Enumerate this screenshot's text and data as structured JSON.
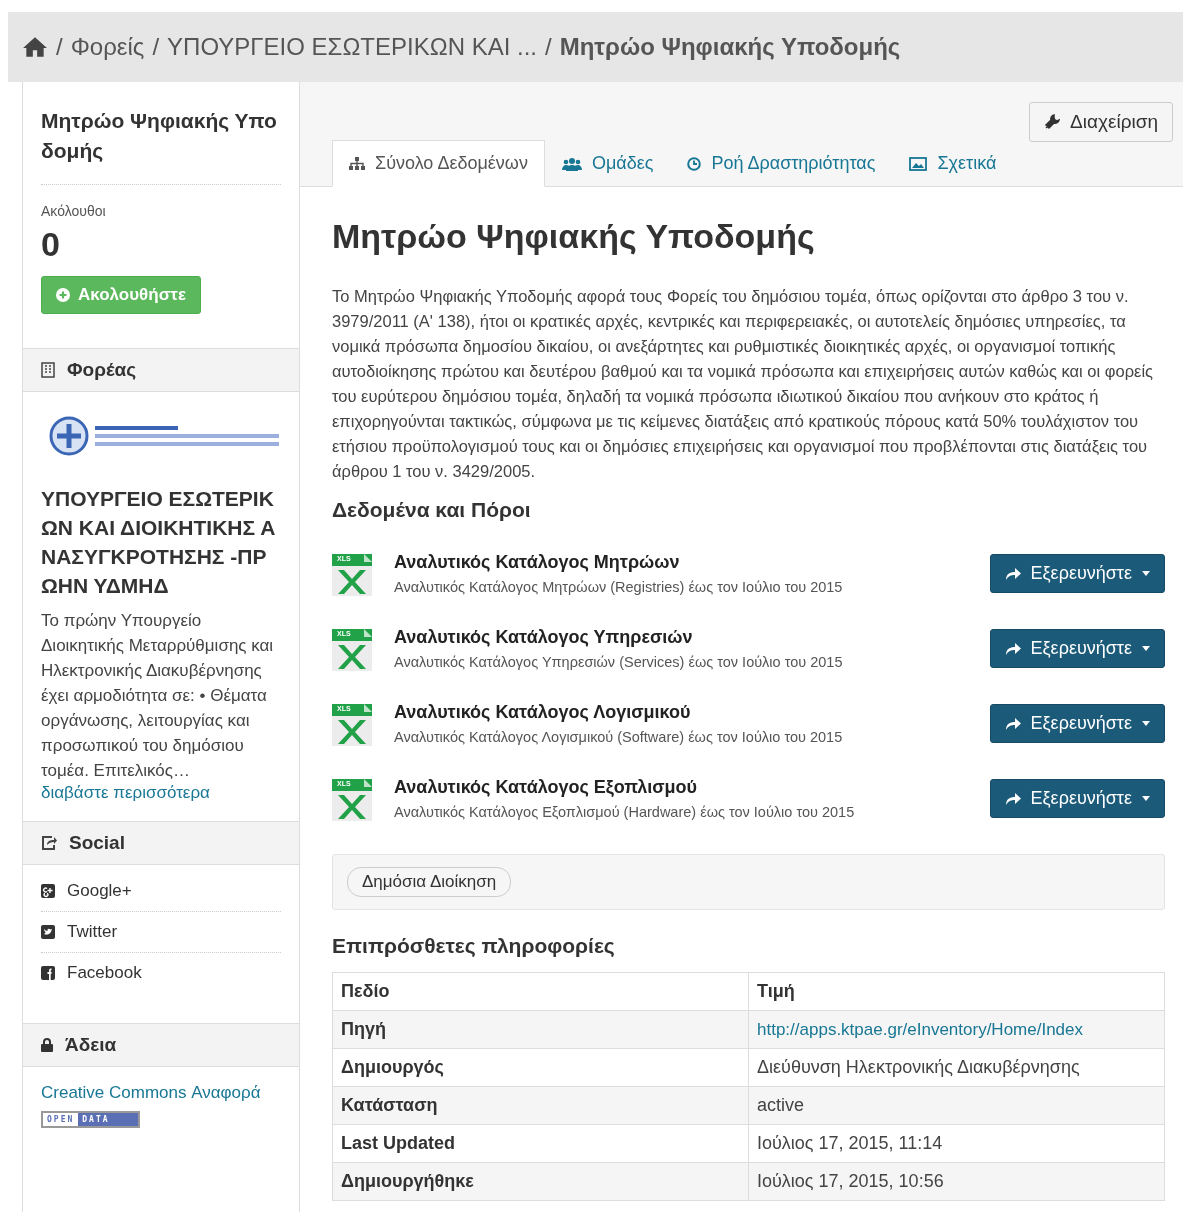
{
  "breadcrumb": {
    "items": [
      "Φορείς",
      "ΥΠΟΥΡΓΕΙΟ ΕΣΩΤΕΡΙΚΩΝ ΚΑΙ ...",
      "Μητρώο Ψηφιακής Υποδομής"
    ],
    "separator": "/"
  },
  "sidebar": {
    "title": "Μητρώο Ψηφιακής Υποδομής",
    "followers_label": "Ακόλουθοι",
    "followers_count": "0",
    "follow_button": "Ακολουθήστε",
    "organization": {
      "heading": "Φορέας",
      "name": "ΥΠΟΥΡΓΕΙΟ ΕΣΩΤΕΡΙΚΩΝ ΚΑΙ ΔΙΟΙΚΗΤΙΚΗΣ ΑΝΑΣΥΓΚΡΟΤΗΣΗΣ -ΠΡΩΗΝ ΥΔΜΗΔ",
      "description": "Το πρώην Υπουργείο Διοικητικής Μεταρρύθμισης και Ηλεκτρονικής Διακυβέρνησης έχει αρμοδιότητα σε: • Θέματα οργάνωσης, λειτουργίας και προσωπικού του δημόσιου τομέα. Επιτελικός…",
      "read_more": "διαβάστε περισσότερα"
    },
    "social": {
      "heading": "Social",
      "items": [
        {
          "kind": "googleplus",
          "label": "Google+"
        },
        {
          "kind": "twitter",
          "label": "Twitter"
        },
        {
          "kind": "facebook",
          "label": "Facebook"
        }
      ]
    },
    "license": {
      "heading": "Άδεια",
      "link": "Creative Commons Αναφορά",
      "badge": [
        "OPEN",
        "DATA"
      ]
    }
  },
  "manage_button": "Διαχείριση",
  "tabs": [
    {
      "kind": "dataset",
      "label": "Σύνολο Δεδομένων",
      "selected": true
    },
    {
      "kind": "groups",
      "label": "Ομάδες",
      "selected": false
    },
    {
      "kind": "activity",
      "label": "Ροή Δραστηριότητας",
      "selected": false
    },
    {
      "kind": "related",
      "label": "Σχετικά",
      "selected": false
    }
  ],
  "dataset": {
    "title": "Μητρώο Ψηφιακής Υποδομής",
    "description": "Το Μητρώο Ψηφιακής Υποδομής αφορά τους Φορείς του δημόσιου τομέα, όπως ορίζονται στο άρθρο 3 του ν. 3979/2011 (Α' 138), ήτοι οι κρατικές αρχές, κεντρικές και περιφερειακές, οι αυτοτελείς δημόσιες υπηρεσίες, τα νομικά πρόσωπα δημοσίου δικαίου, οι ανεξάρτητες και ρυθμιστικές διοικητικές αρχές, οι οργανισμοί τοπικής αυτοδιοίκησης πρώτου και δευτέρου βαθμού και τα νομικά πρόσωπα και επιχειρήσεις αυτών καθώς και οι φορείς του ευρύτερου δημόσιου τομέα, δηλαδή τα νομικά πρόσωπα ιδιωτικού δικαίου που ανήκουν στο κράτος ή επιχορηγούνται τακτικώς, σύμφωνα με τις κείμενες διατάξεις από κρατικούς πόρους κατά 50% τουλάχιστον του ετήσιου προϋπολογισμού τους και οι δημόσιες επιχειρήσεις και οργανισμοί που προβλέπονται στις διατάξεις του άρθρου 1 του ν. 3429/2005."
  },
  "resources_heading": "Δεδομένα και Πόροι",
  "resources": [
    {
      "title": "Αναλυτικός Κατάλογος Μητρώων",
      "description": "Αναλυτικός Κατάλογος Μητρώων (Registries) έως τον Ιούλιο του 2015",
      "format": "XLS",
      "button": "Εξερευνήστε"
    },
    {
      "title": "Αναλυτικός Κατάλογος Υπηρεσιών",
      "description": "Αναλυτικός Κατάλογος Υπηρεσιών (Services) έως τον Ιούλιο του 2015",
      "format": "XLS",
      "button": "Εξερευνήστε"
    },
    {
      "title": "Αναλυτικός Κατάλογος Λογισμικού",
      "description": "Αναλυτικός Κατάλογος Λογισμικού (Software) έως τον Ιούλιο του 2015",
      "format": "XLS",
      "button": "Εξερευνήστε"
    },
    {
      "title": "Αναλυτικός Κατάλογος Εξοπλισμού",
      "description": "Αναλυτικός Κατάλογος Εξοπλισμού (Hardware) έως τον Ιούλιο του 2015",
      "format": "XLS",
      "button": "Εξερευνήστε"
    }
  ],
  "tags": [
    "Δημόσια Διοίκηση"
  ],
  "additional_info": {
    "heading": "Επιπρόσθετες πληροφορίες",
    "columns": [
      "Πεδίο",
      "Τιμή"
    ],
    "rows": [
      {
        "field": "Πηγή",
        "value": "http://apps.ktpae.gr/eInventory/Home/Index",
        "kind": "link"
      },
      {
        "field": "Δημιουργός",
        "value": "Διεύθυνση Ηλεκτρονικής Διακυβέρνησης",
        "kind": "text"
      },
      {
        "field": "Κατάσταση",
        "value": "active",
        "kind": "text"
      },
      {
        "field": "Last Updated",
        "value": "Ιούλιος 17, 2015, 11:14",
        "kind": "text"
      },
      {
        "field": "Δημιουργήθηκε",
        "value": "Ιούλιος 17, 2015, 10:56",
        "kind": "text"
      }
    ]
  }
}
